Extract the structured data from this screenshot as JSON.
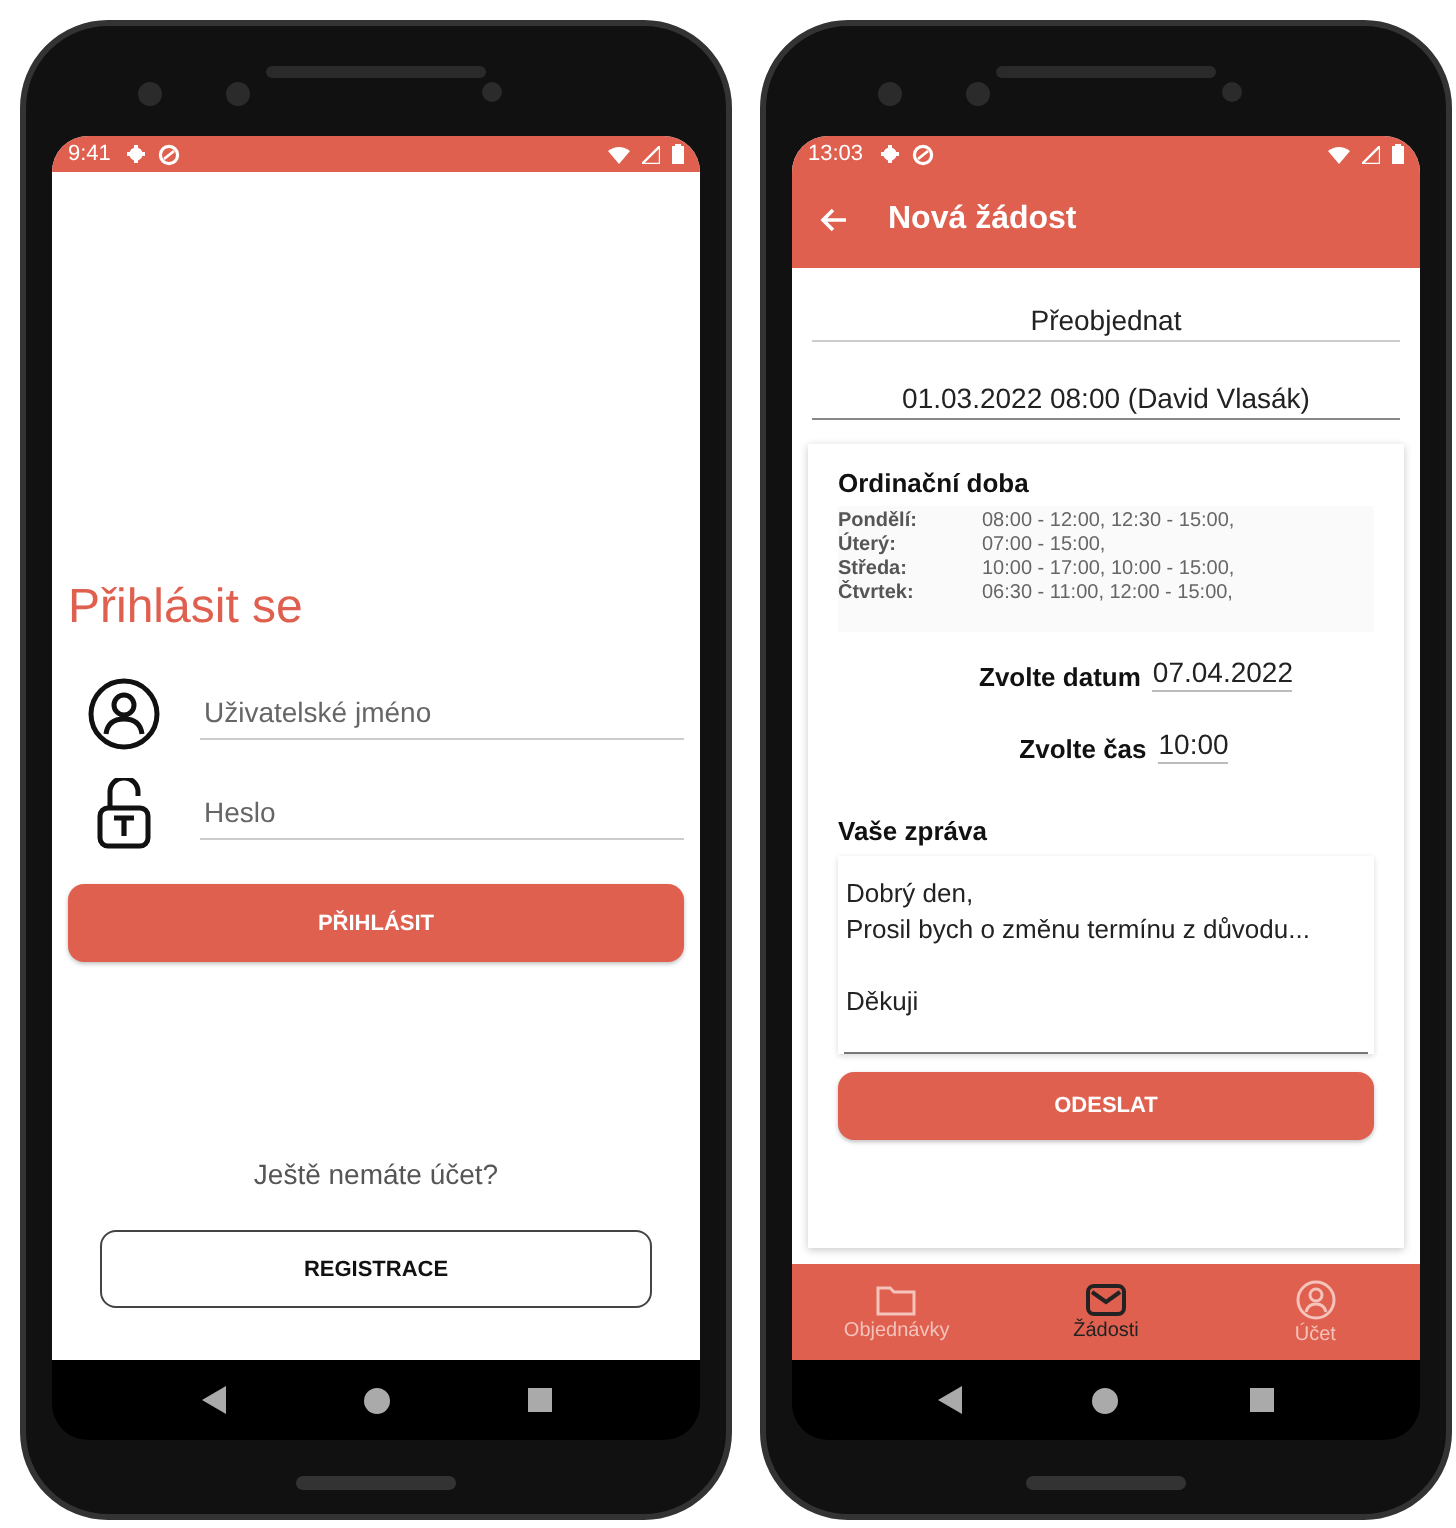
{
  "login_screen": {
    "status_bar": {
      "time": "9:41"
    },
    "title": "Přihlásit se",
    "fields": [
      {
        "kind": "user",
        "placeholder": "Uživatelské jméno"
      },
      {
        "kind": "lock",
        "placeholder": "Heslo"
      }
    ],
    "login_button": "PŘIHLÁSIT",
    "register_prompt": "Ještě nemáte účet?",
    "register_button": "REGISTRACE"
  },
  "request_screen": {
    "status_bar": {
      "time": "13:03"
    },
    "app_bar": {
      "title": "Nová žádost"
    },
    "request_type": "Přeobjednat",
    "appointment": "01.03.2022 08:00 (David Vlasák)",
    "hours": {
      "title": "Ordinační doba",
      "rows": [
        {
          "day": "Pondělí:",
          "times": "08:00 - 12:00, 12:30 - 15:00,"
        },
        {
          "day": "Úterý:",
          "times": "07:00 - 15:00,"
        },
        {
          "day": "Středa:",
          "times": "10:00 - 17:00, 10:00 - 15:00,"
        },
        {
          "day": "Čtvrtek:",
          "times": "06:30 - 11:00, 12:00 - 15:00,"
        }
      ]
    },
    "date": {
      "label": "Zvolte datum",
      "value": "07.04.2022"
    },
    "time": {
      "label": "Zvolte čas",
      "value": "10:00"
    },
    "message": {
      "label": "Vaše zpráva",
      "value": "Dobrý den,\nProsil bych o změnu termínu z důvodu...\n\nDěkuji"
    },
    "send_button": "ODESLAT",
    "bottom_tabs": [
      {
        "kind": "folder",
        "label": "Objednávky",
        "selected": false
      },
      {
        "kind": "mail",
        "label": "Žádosti",
        "selected": true
      },
      {
        "kind": "user",
        "label": "Účet",
        "selected": false
      }
    ]
  }
}
